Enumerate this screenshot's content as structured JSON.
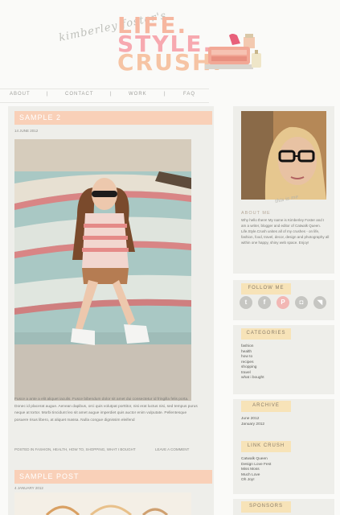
{
  "header": {
    "script_name": "kimberley foster's",
    "logo": [
      "LIFE.",
      "STYLE.",
      "CRUSH."
    ]
  },
  "nav": {
    "items": [
      "ABOUT",
      "CONTACT",
      "WORK",
      "FAQ"
    ],
    "separator": "|"
  },
  "posts": [
    {
      "title": "SAMPLE 2",
      "date": "14 JUNE 2012",
      "body": "Fusce a ante a elit aliquet iaculis. Fusce bibendum dolor sit amet dui consectetur id fringilla felis porta. Donec id placerat augue. Aenean dapibus, orci quis volutpat porttitor, nisi erat luctus nisi, sed tempus purus neque at tortor. Morbi tincidunt leo sit amet augue imperdiet quis auctor enim vulputate. Pellentesque posuere risus libero, at aliquet massa. Nulla congue dignissim eleifend",
      "meta": "POSTED IN FASHION, HEALTH, HOW TO, SHOPPING, WHAT I BOUGHT",
      "comment": "LEAVE A COMMENT"
    },
    {
      "title": "SAMPLE POST",
      "date": "4 JANUARY 2012"
    }
  ],
  "sidebar": {
    "this_is_me": "this is me",
    "about_title": "ABOUT ME",
    "about_text": "Why hello there! My name is Kimberley Foster and I am a writer, blogger and editor of Catwalk Queen. Life.Style.Crush unites all of my crushes - on life, fashion, food, travel, decor, design and photography all within one happy, shiny web space. Enjoy!",
    "follow_title": "FOLLOW ME",
    "social": [
      {
        "icon": "twitter-icon",
        "glyph": "t"
      },
      {
        "icon": "facebook-icon",
        "glyph": "f"
      },
      {
        "icon": "pinterest-icon",
        "glyph": "P"
      },
      {
        "icon": "instagram-icon",
        "glyph": "◘"
      },
      {
        "icon": "rss-icon",
        "glyph": "◥"
      }
    ],
    "categories_title": "CATEGORIES",
    "categories": [
      "fashion",
      "health",
      "how to",
      "recipes",
      "shopping",
      "travel",
      "what i bought"
    ],
    "archive_title": "ARCHIVE",
    "archive": [
      "June 2012",
      "January 2012"
    ],
    "linkcrush_title": "LINK CRUSH",
    "links": [
      "Catwalk Queen",
      "Design Love Fest",
      "Miss Moss",
      "Much Love",
      "Oh Joy!"
    ],
    "sponsors_title": "SPONSORS"
  },
  "colors": {
    "post_title_bg": "#f9d0b8",
    "side_head_bg": "#f7e3b8",
    "logo_peach": "#f6b7a0",
    "logo_pink": "#f7a9b0"
  }
}
